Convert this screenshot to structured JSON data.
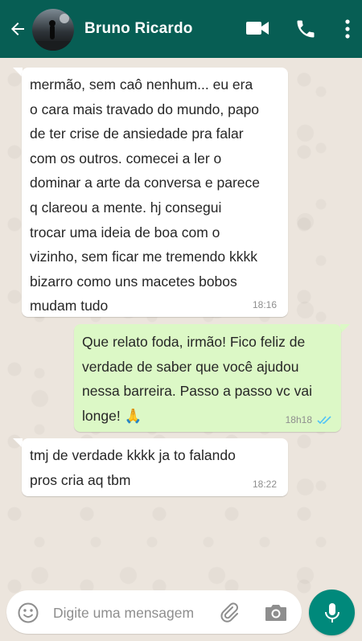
{
  "header": {
    "contact_name": "Bruno Ricardo"
  },
  "messages": [
    {
      "direction": "in",
      "text": "mermão, sem caô nenhum... eu era\no cara mais travado do mundo, papo\nde ter crise de ansiedade pra falar\ncom os outros. comecei a ler o\ndominar a arte da conversa e parece\nq clareou a mente. hj consegui\ntrocar uma ideia de boa com o\nvizinho, sem ficar me tremendo kkkk\nbizarro como uns macetes bobos\nmudam tudo",
      "time": "18:16"
    },
    {
      "direction": "out",
      "text": "Que relato foda, irmão! Fico feliz de\nverdade de saber que você ajudou\nnessa barreira. Passo a passo vc vai\nlonge! 🙏",
      "time": "18h18",
      "status": "read"
    },
    {
      "direction": "in",
      "text": "tmj de verdade kkkk ja to falando\npros cria aq tbm",
      "time": "18:22"
    }
  ],
  "composer": {
    "placeholder": "Digite uma mensagem"
  },
  "icons": {
    "back": "back-arrow-icon",
    "video": "video-call-icon",
    "phone": "phone-icon",
    "menu": "more-vert-icon",
    "emoji": "emoji-icon",
    "attach": "paperclip-icon",
    "camera": "camera-icon",
    "mic": "mic-icon"
  },
  "colors": {
    "header": "#075e54",
    "outgoing_bubble": "#dcf8c6",
    "incoming_bubble": "#ffffff",
    "mic_button": "#00897b",
    "read_ticks": "#4fc3f7"
  }
}
